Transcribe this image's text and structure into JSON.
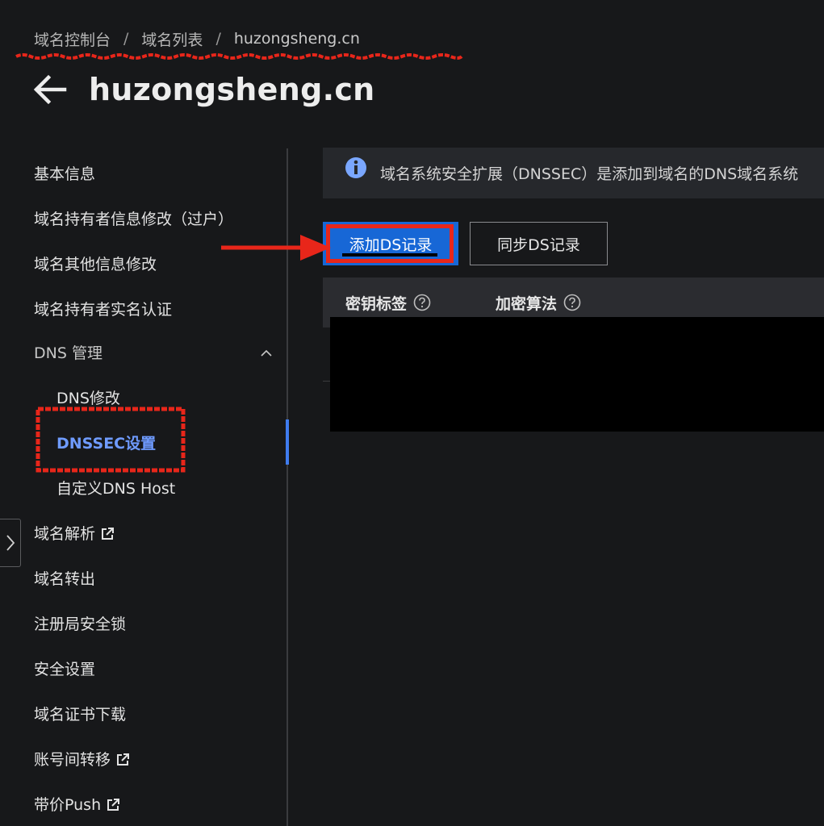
{
  "breadcrumb": {
    "items": [
      "域名控制台",
      "域名列表",
      "huzongsheng.cn"
    ],
    "separator": "/"
  },
  "page": {
    "title": "huzongsheng.cn",
    "back_icon": "arrow-left-icon"
  },
  "sidebar": {
    "items": [
      {
        "label": "基本信息"
      },
      {
        "label": "域名持有者信息修改（过户）"
      },
      {
        "label": "域名其他信息修改"
      },
      {
        "label": "域名持有者实名认证"
      }
    ],
    "dns_group": {
      "label": "DNS 管理",
      "children": [
        {
          "label": "DNS修改"
        },
        {
          "label": "DNSSEC设置",
          "active": true
        },
        {
          "label": "自定义DNS Host"
        }
      ]
    },
    "items_after": [
      {
        "label": "域名解析",
        "external": true
      },
      {
        "label": "域名转出"
      },
      {
        "label": "注册局安全锁"
      },
      {
        "label": "安全设置"
      },
      {
        "label": "域名证书下载"
      },
      {
        "label": "账号间转移",
        "external": true
      },
      {
        "label": "带价Push",
        "external": true
      }
    ]
  },
  "alert": {
    "text": "域名系统安全扩展（DNSSEC）是添加到域名的DNS域名系统",
    "icon": "info-icon"
  },
  "actions": {
    "add_ds": "添加DS记录",
    "sync_ds": "同步DS记录"
  },
  "table": {
    "columns": [
      {
        "label": "密钥标签",
        "help": true
      },
      {
        "label": "加密算法",
        "help": true
      }
    ]
  },
  "colors": {
    "background": "#17181a",
    "accent": "#1767d6",
    "active_text": "#6f9bff",
    "annotation_red": "#e8261a"
  }
}
